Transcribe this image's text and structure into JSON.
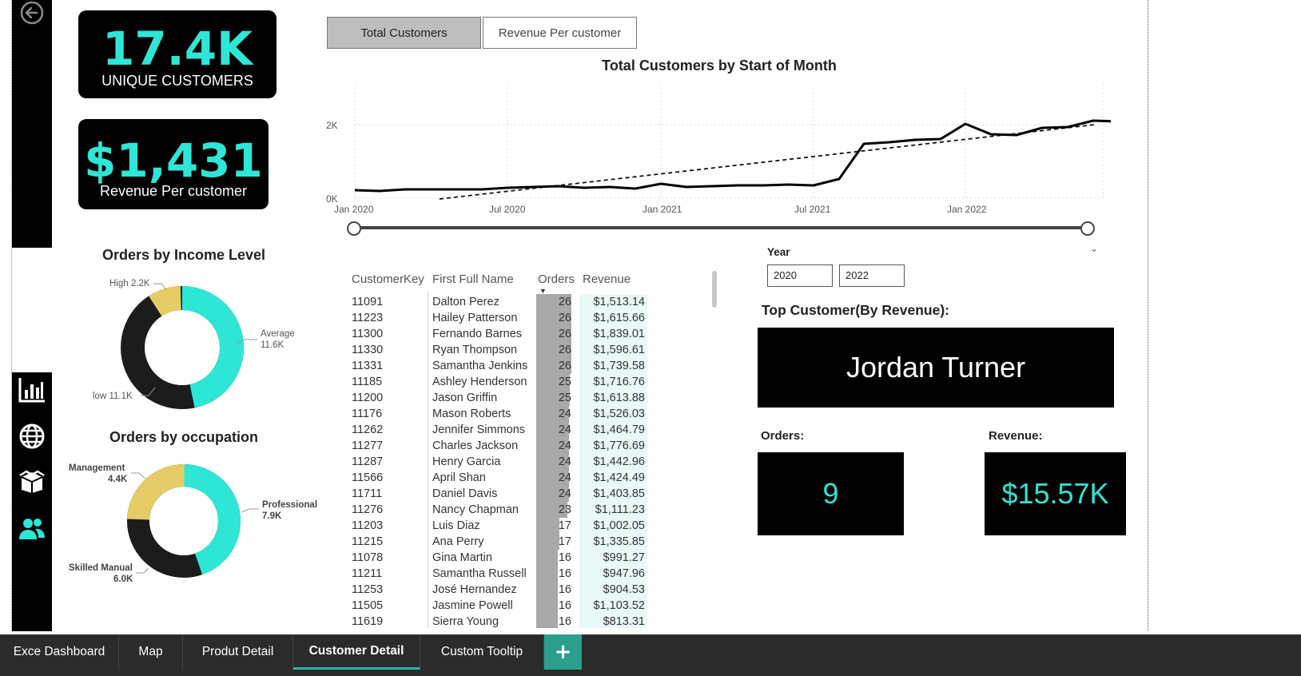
{
  "kpis": {
    "unique_customers": {
      "value": "17.4K",
      "label": "UNIQUE CUSTOMERS"
    },
    "revenue_per_customer": {
      "value": "$1,431",
      "label": "Revenue Per customer"
    }
  },
  "toggle": {
    "active": "Total Customers",
    "inactive": "Revenue Per customer"
  },
  "line_chart": {
    "title": "Total Customers by Start of Month",
    "y_ticks": [
      "2K",
      "0K"
    ],
    "x_ticks": [
      "Jan 2020",
      "Jul 2020",
      "Jan 2021",
      "Jul 2021",
      "Jan 2022"
    ]
  },
  "income_chart": {
    "title": "Orders by Income Level",
    "labels": [
      {
        "name": "High",
        "value": "2.2K"
      },
      {
        "name": "Average",
        "value": "11.6K"
      },
      {
        "name": "low",
        "value": "11.1K"
      }
    ]
  },
  "occupation_chart": {
    "title": "Orders by occupation",
    "labels": [
      {
        "name": "Management",
        "value": "4.4K"
      },
      {
        "name": "Professional",
        "value": "7.9K"
      },
      {
        "name": "Skilled Manual",
        "value": "6.0K"
      }
    ]
  },
  "table": {
    "headers": [
      "CustomerKey",
      "First Full Name",
      "Orders",
      "Revenue"
    ],
    "rows": [
      [
        "11091",
        "Dalton Perez",
        "26",
        "$1,513.14"
      ],
      [
        "11223",
        "Hailey Patterson",
        "26",
        "$1,615.66"
      ],
      [
        "11300",
        "Fernando Barnes",
        "26",
        "$1,839.01"
      ],
      [
        "11330",
        "Ryan Thompson",
        "26",
        "$1,596.61"
      ],
      [
        "11331",
        "Samantha Jenkins",
        "26",
        "$1,739.58"
      ],
      [
        "11185",
        "Ashley Henderson",
        "25",
        "$1,716.76"
      ],
      [
        "11200",
        "Jason Griffin",
        "25",
        "$1,613.88"
      ],
      [
        "11176",
        "Mason Roberts",
        "24",
        "$1,526.03"
      ],
      [
        "11262",
        "Jennifer Simmons",
        "24",
        "$1,464.79"
      ],
      [
        "11277",
        "Charles Jackson",
        "24",
        "$1,776.69"
      ],
      [
        "11287",
        "Henry Garcia",
        "24",
        "$1,442.96"
      ],
      [
        "11566",
        "April Shan",
        "24",
        "$1,424.49"
      ],
      [
        "11711",
        "Daniel Davis",
        "24",
        "$1,403.85"
      ],
      [
        "11276",
        "Nancy Chapman",
        "23",
        "$1,111.23"
      ],
      [
        "11203",
        "Luis Diaz",
        "17",
        "$1,002.05"
      ],
      [
        "11215",
        "Ana Perry",
        "17",
        "$1,335.85"
      ],
      [
        "11078",
        "Gina Martin",
        "16",
        "$991.27"
      ],
      [
        "11211",
        "Samantha Russell",
        "16",
        "$947.96"
      ],
      [
        "11253",
        "José Hernandez",
        "16",
        "$904.53"
      ],
      [
        "11505",
        "Jasmine Powell",
        "16",
        "$1,103.52"
      ],
      [
        "11619",
        "Sierra Young",
        "16",
        "$813.31"
      ]
    ]
  },
  "year_slicer": {
    "label": "Year",
    "start": "2020",
    "end": "2022"
  },
  "top_customer": {
    "title": "Top Customer(By Revenue):",
    "name": "Jordan Turner",
    "orders_label": "Orders:",
    "orders_value": "9",
    "revenue_label": "Revenue:",
    "revenue_value": "$15.57K"
  },
  "tabs": [
    "Exce Dashboard",
    "Map",
    "Produt Detail",
    "Customer Detail",
    "Custom Tooltip"
  ],
  "tabs_add": "+",
  "colors": {
    "accent": "#2ee6d6",
    "yellow": "#e6cc66",
    "dark": "#1c1c1c",
    "tab_active": "#2ab3a0"
  }
}
